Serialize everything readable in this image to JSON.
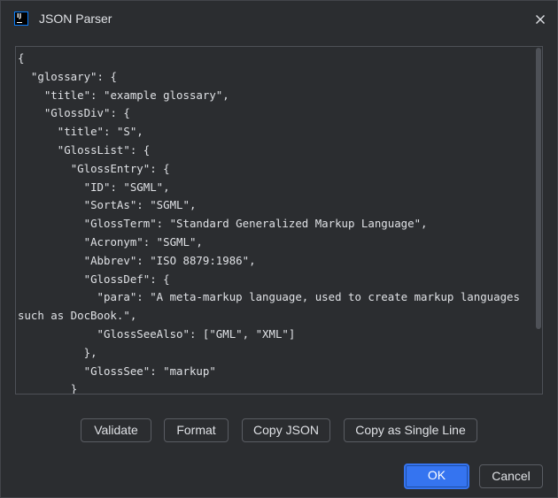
{
  "dialog": {
    "title": "JSON Parser",
    "app_icon": "intellij-icon",
    "close_icon": "close-icon"
  },
  "editor": {
    "content": "{\n  \"glossary\": {\n    \"title\": \"example glossary\",\n    \"GlossDiv\": {\n      \"title\": \"S\",\n      \"GlossList\": {\n        \"GlossEntry\": {\n          \"ID\": \"SGML\",\n          \"SortAs\": \"SGML\",\n          \"GlossTerm\": \"Standard Generalized Markup Language\",\n          \"Acronym\": \"SGML\",\n          \"Abbrev\": \"ISO 8879:1986\",\n          \"GlossDef\": {\n            \"para\": \"A meta-markup language, used to create markup languages such as DocBook.\",\n            \"GlossSeeAlso\": [\"GML\", \"XML\"]\n          },\n          \"GlossSee\": \"markup\"\n        }\n      }\n    }\n  }\n}"
  },
  "actions": {
    "validate": "Validate",
    "format": "Format",
    "copy_json": "Copy JSON",
    "copy_single_line": "Copy as Single Line"
  },
  "footer": {
    "ok": "OK",
    "cancel": "Cancel"
  },
  "colors": {
    "background": "#2b2d30",
    "border": "#4e5157",
    "text": "#dfe1e5",
    "accent": "#3574f0"
  }
}
